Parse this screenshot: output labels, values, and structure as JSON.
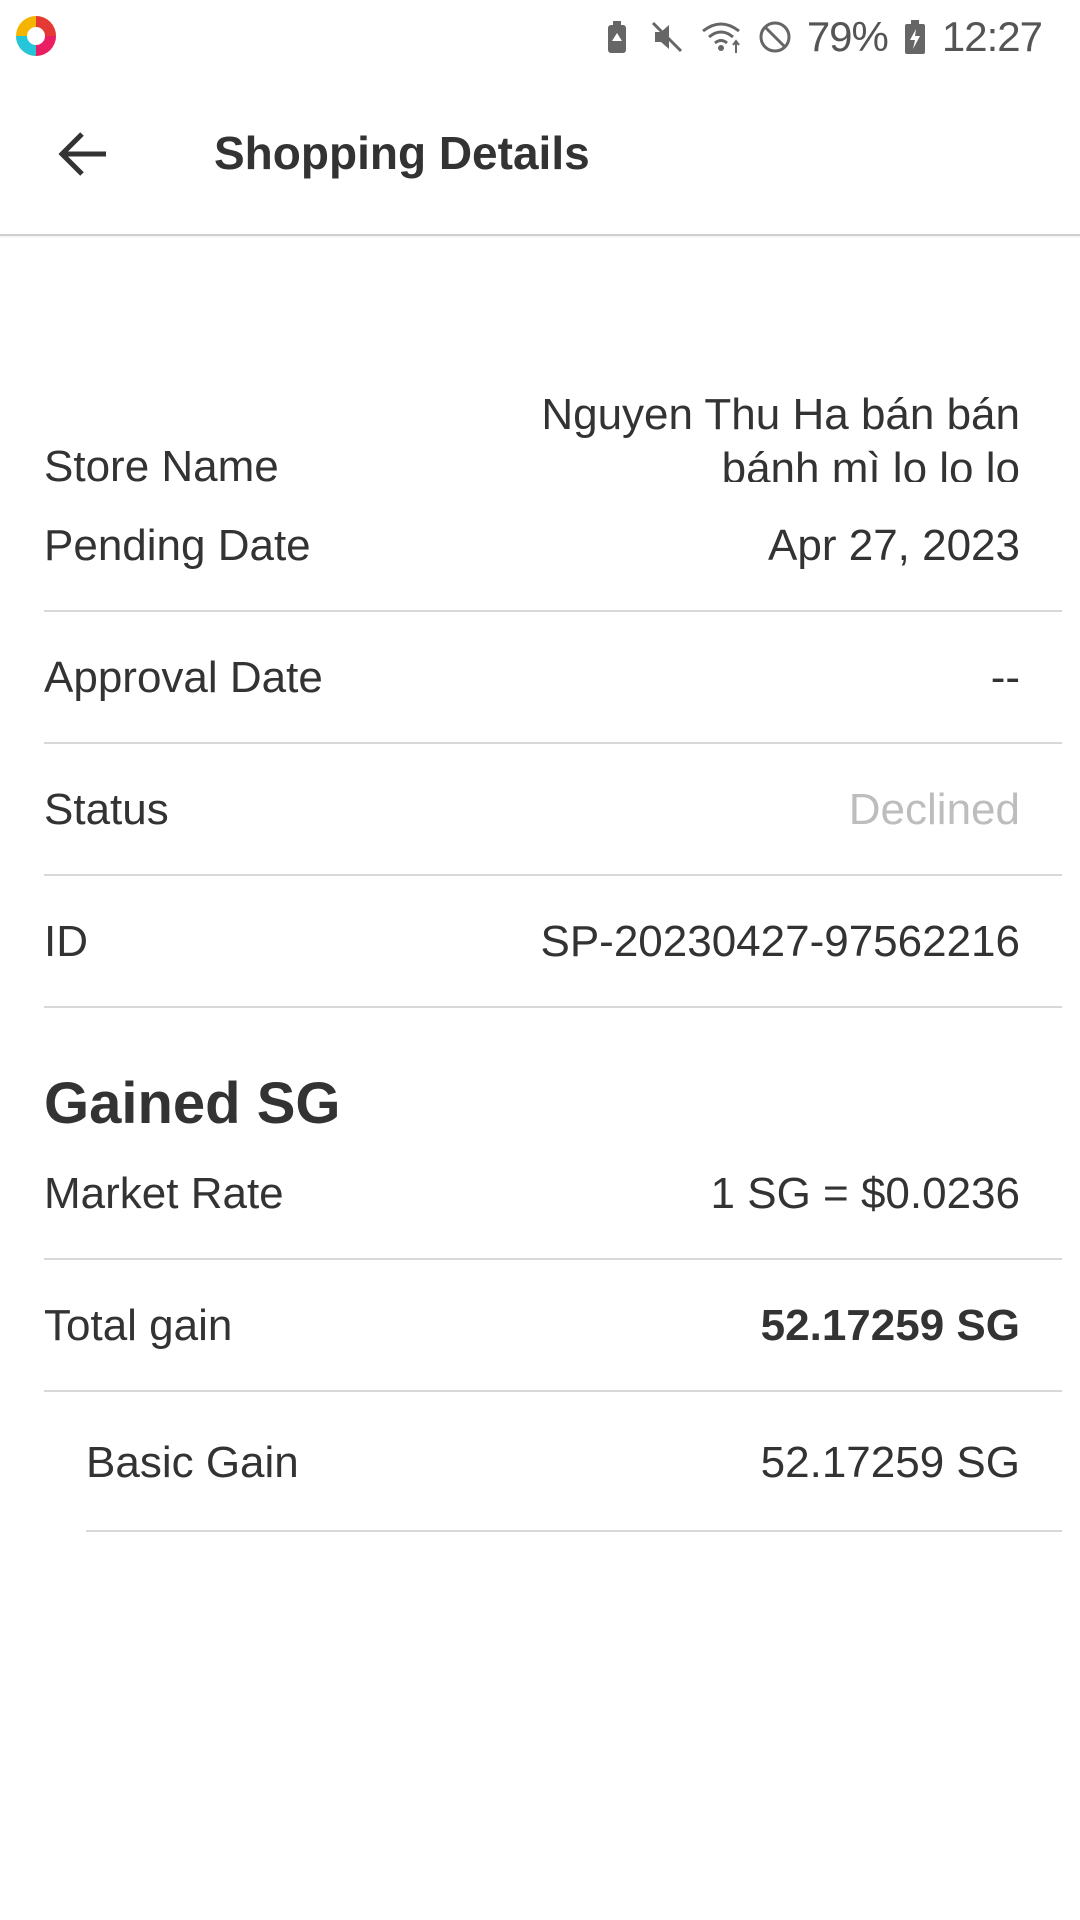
{
  "status_bar": {
    "battery_percent": "79%",
    "time": "12:27",
    "icons": [
      "app-logo-icon",
      "battery-saver-icon",
      "mute-icon",
      "wifi-icon",
      "do-not-disturb-icon",
      "battery-charging-icon"
    ]
  },
  "app_bar": {
    "title": "Shopping Details",
    "back_icon": "arrow-left-icon"
  },
  "details": {
    "store": {
      "label": "Store Name",
      "value": "Nguyen Thu Ha bán bán bánh mì lo lo lo"
    },
    "rows": [
      {
        "label": "Pending Date",
        "value": "Apr 27, 2023"
      },
      {
        "label": "Approval Date",
        "value": "--"
      },
      {
        "label": "Status",
        "value": "Declined",
        "color": "#bdbdbd"
      },
      {
        "label": "ID",
        "value": "SP-20230427-97562216"
      }
    ]
  },
  "gained": {
    "title": "Gained SG",
    "rows": [
      {
        "label": "Market Rate",
        "value": "1 SG = $0.0236"
      },
      {
        "label": "Total gain",
        "value": "52.17259 SG"
      }
    ],
    "sub_rows": [
      {
        "label": "Basic Gain",
        "value": "52.17259 SG"
      }
    ]
  }
}
